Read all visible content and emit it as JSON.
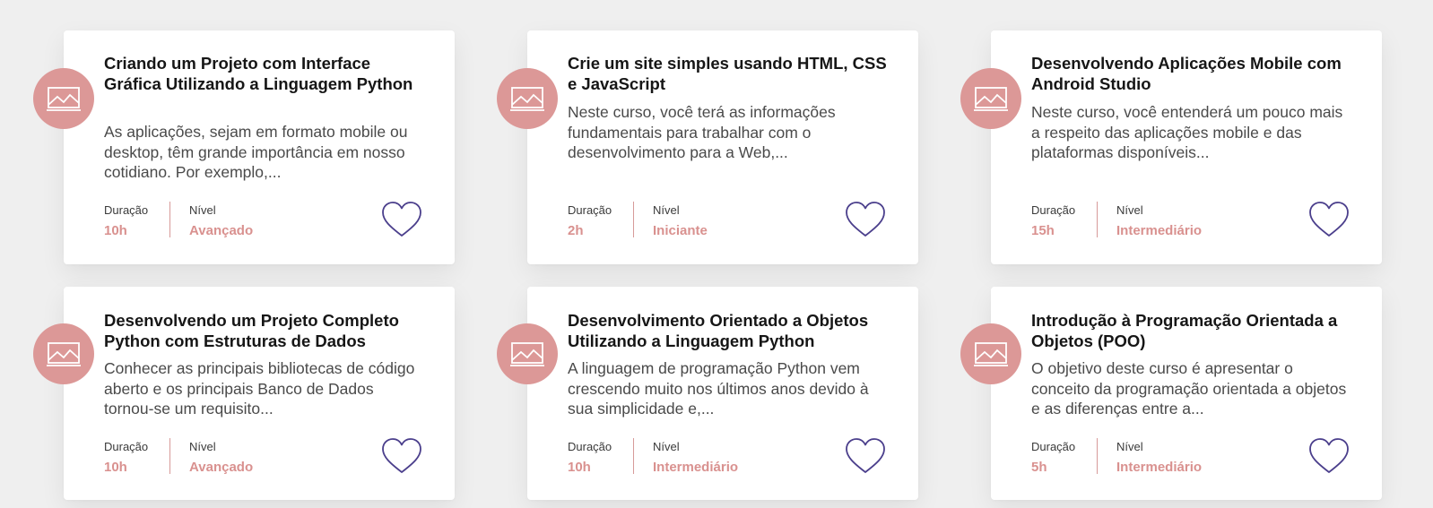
{
  "courses": [
    {
      "title": "Criando um Projeto com Interface Gráfica Utilizando a Linguagem Python",
      "description": "As aplicações, sejam em formato mobile ou desktop, têm grande importância em nosso cotidiano. Por exemplo,...",
      "duration_label": "Duração",
      "duration": "10h",
      "level_label": "Nível",
      "level": "Avançado"
    },
    {
      "title": "Crie um site simples usando HTML, CSS e JavaScript",
      "description": "Neste curso, você terá as informações fundamentais para trabalhar com o desenvolvimento para a Web,...",
      "duration_label": "Duração",
      "duration": "2h",
      "level_label": "Nível",
      "level": "Iniciante"
    },
    {
      "title": "Desenvolvendo Aplicações Mobile com Android Studio",
      "description": "Neste curso, você entenderá um pouco mais a respeito das aplicações mobile e das plataformas disponíveis...",
      "duration_label": "Duração",
      "duration": "15h",
      "level_label": "Nível",
      "level": "Intermediário"
    },
    {
      "title": "Desenvolvendo um Projeto Completo Python com Estruturas de Dados",
      "description": "Conhecer as principais bibliotecas de código aberto e os principais Banco de Dados tornou-se um requisito...",
      "duration_label": "Duração",
      "duration": "10h",
      "level_label": "Nível",
      "level": "Avançado"
    },
    {
      "title": "Desenvolvimento Orientado a Objetos Utilizando a Linguagem Python",
      "description": "A linguagem de programação Python vem crescendo muito nos últimos anos devido à sua simplicidade e,...",
      "duration_label": "Duração",
      "duration": "10h",
      "level_label": "Nível",
      "level": "Intermediário"
    },
    {
      "title": "Introdução à Programação Orientada a Objetos (POO)",
      "description": "O objetivo deste curso é apresentar o conceito da programação orientada a objetos e as diferenças entre a...",
      "duration_label": "Duração",
      "duration": "5h",
      "level_label": "Nível",
      "level": "Intermediário"
    }
  ],
  "icons": {
    "thumbnail": "image-placeholder-icon",
    "favorite": "heart-outline-icon"
  },
  "colors": {
    "accent": "#dc9897",
    "heart": "#4b3f8c",
    "background": "#efefef"
  }
}
